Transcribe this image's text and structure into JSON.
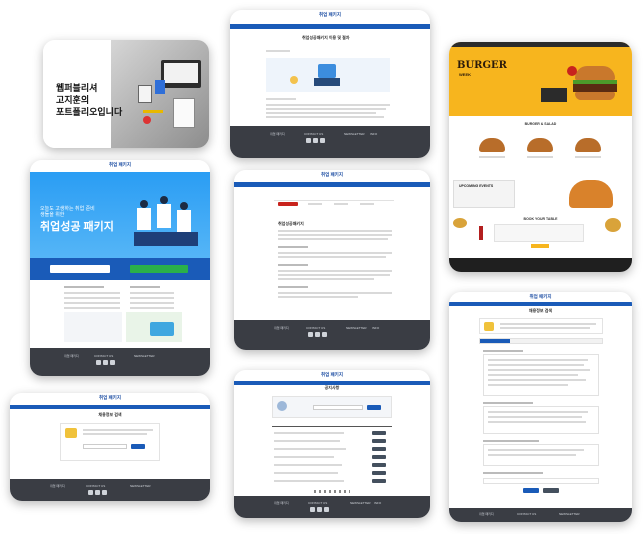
{
  "portfolio": {
    "card1": {
      "intro_line1": "웹퍼블리셔",
      "intro_line2": "고지훈의",
      "intro_line3": "포트폴리오입니다"
    },
    "site_logo": "취업 패키지",
    "card2": {
      "page_title": "취업성공패키지 이용 및 절차"
    },
    "card3": {
      "hero_title": "취업성공 패키지",
      "hero_subtitle": "오늘도 고생하는 취업 준비생들을 위한"
    },
    "card4": {
      "page_title": "취업성공패키지"
    },
    "card5": {
      "brand": "BURGER",
      "brand_sub": "WEEK",
      "section1": "BURGER & SALAD",
      "section2": "UPCOMING EVENTS",
      "section3": "BOOK YOUR TABLE"
    },
    "card6": {
      "page_title": "채용정보 검색"
    },
    "card7": {
      "page_title": "공지사항"
    },
    "card8": {
      "page_title": "채용정보 검색"
    },
    "footer_label": "CONTACT US"
  },
  "colors": {
    "brand_blue": "#1a5bb8",
    "footer_dark": "#3a3d44",
    "burger_yellow": "#f7b51e",
    "burger_red": "#c8231d"
  }
}
